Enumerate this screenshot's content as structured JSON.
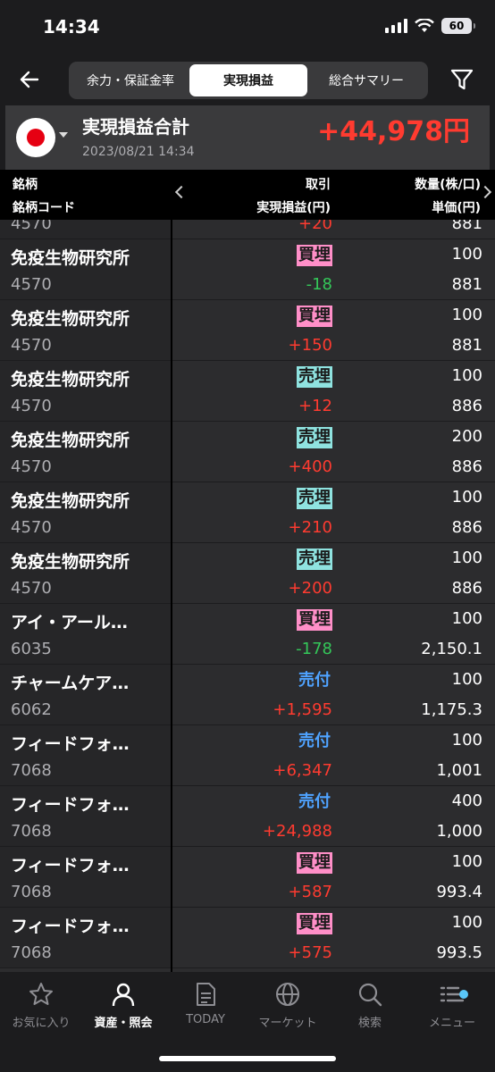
{
  "status": {
    "time": "14:34",
    "battery": "60"
  },
  "tabs": [
    {
      "label": "余力・保証金率"
    },
    {
      "label": "実現損益",
      "active": true
    },
    {
      "label": "総合サマリー"
    }
  ],
  "summary": {
    "title": "実現損益合計",
    "date": "2023/08/21 14:34",
    "total": "+44,978円"
  },
  "columns": {
    "name": "銘柄",
    "code": "銘柄コード",
    "trade": "取引",
    "pnl": "実現損益(円)",
    "qty": "数量(株/口)",
    "price": "単価(円)"
  },
  "partial_row": {
    "code": "4570",
    "pnl": "+20",
    "price": "881"
  },
  "rows": [
    {
      "name": "免疫生物研究所",
      "code": "4570",
      "trade": "買埋",
      "trade_style": "buy",
      "pnl": "-18",
      "pnl_sign": "neg",
      "qty": "100",
      "price": "881"
    },
    {
      "name": "免疫生物研究所",
      "code": "4570",
      "trade": "買埋",
      "trade_style": "buy",
      "pnl": "+150",
      "pnl_sign": "pos",
      "qty": "100",
      "price": "881"
    },
    {
      "name": "免疫生物研究所",
      "code": "4570",
      "trade": "売埋",
      "trade_style": "sell",
      "pnl": "+12",
      "pnl_sign": "pos",
      "qty": "100",
      "price": "886"
    },
    {
      "name": "免疫生物研究所",
      "code": "4570",
      "trade": "売埋",
      "trade_style": "sell",
      "pnl": "+400",
      "pnl_sign": "pos",
      "qty": "200",
      "price": "886"
    },
    {
      "name": "免疫生物研究所",
      "code": "4570",
      "trade": "売埋",
      "trade_style": "sell",
      "pnl": "+210",
      "pnl_sign": "pos",
      "qty": "100",
      "price": "886"
    },
    {
      "name": "免疫生物研究所",
      "code": "4570",
      "trade": "売埋",
      "trade_style": "sell",
      "pnl": "+200",
      "pnl_sign": "pos",
      "qty": "100",
      "price": "886"
    },
    {
      "name": "アイ・アール…",
      "code": "6035",
      "trade": "買埋",
      "trade_style": "buy",
      "pnl": "-178",
      "pnl_sign": "neg",
      "qty": "100",
      "price": "2,150.1"
    },
    {
      "name": "チャームケア…",
      "code": "6062",
      "trade": "売付",
      "trade_style": "plain",
      "pnl": "+1,595",
      "pnl_sign": "pos",
      "qty": "100",
      "price": "1,175.3"
    },
    {
      "name": "フィードフォ…",
      "code": "7068",
      "trade": "売付",
      "trade_style": "plain",
      "pnl": "+6,347",
      "pnl_sign": "pos",
      "qty": "100",
      "price": "1,001"
    },
    {
      "name": "フィードフォ…",
      "code": "7068",
      "trade": "売付",
      "trade_style": "plain",
      "pnl": "+24,988",
      "pnl_sign": "pos",
      "qty": "400",
      "price": "1,000"
    },
    {
      "name": "フィードフォ…",
      "code": "7068",
      "trade": "買埋",
      "trade_style": "buy",
      "pnl": "+587",
      "pnl_sign": "pos",
      "qty": "100",
      "price": "993.4"
    },
    {
      "name": "フィードフォ…",
      "code": "7068",
      "trade": "買埋",
      "trade_style": "buy",
      "pnl": "+575",
      "pnl_sign": "pos",
      "qty": "100",
      "price": "993.5"
    }
  ],
  "bottom_nav": [
    {
      "label": "お気に入り",
      "icon": "star-icon"
    },
    {
      "label": "資産・照会",
      "icon": "person-icon",
      "active": true
    },
    {
      "label": "TODAY",
      "icon": "document-icon"
    },
    {
      "label": "マーケット",
      "icon": "globe-icon"
    },
    {
      "label": "検索",
      "icon": "search-icon"
    },
    {
      "label": "メニュー",
      "icon": "menu-icon"
    }
  ],
  "colors": {
    "positive": "#ff3b30",
    "negative": "#34c759",
    "buy_badge": "#ff8fc8",
    "sell_badge": "#8fe3e0",
    "order_text": "#4fa3ff"
  }
}
